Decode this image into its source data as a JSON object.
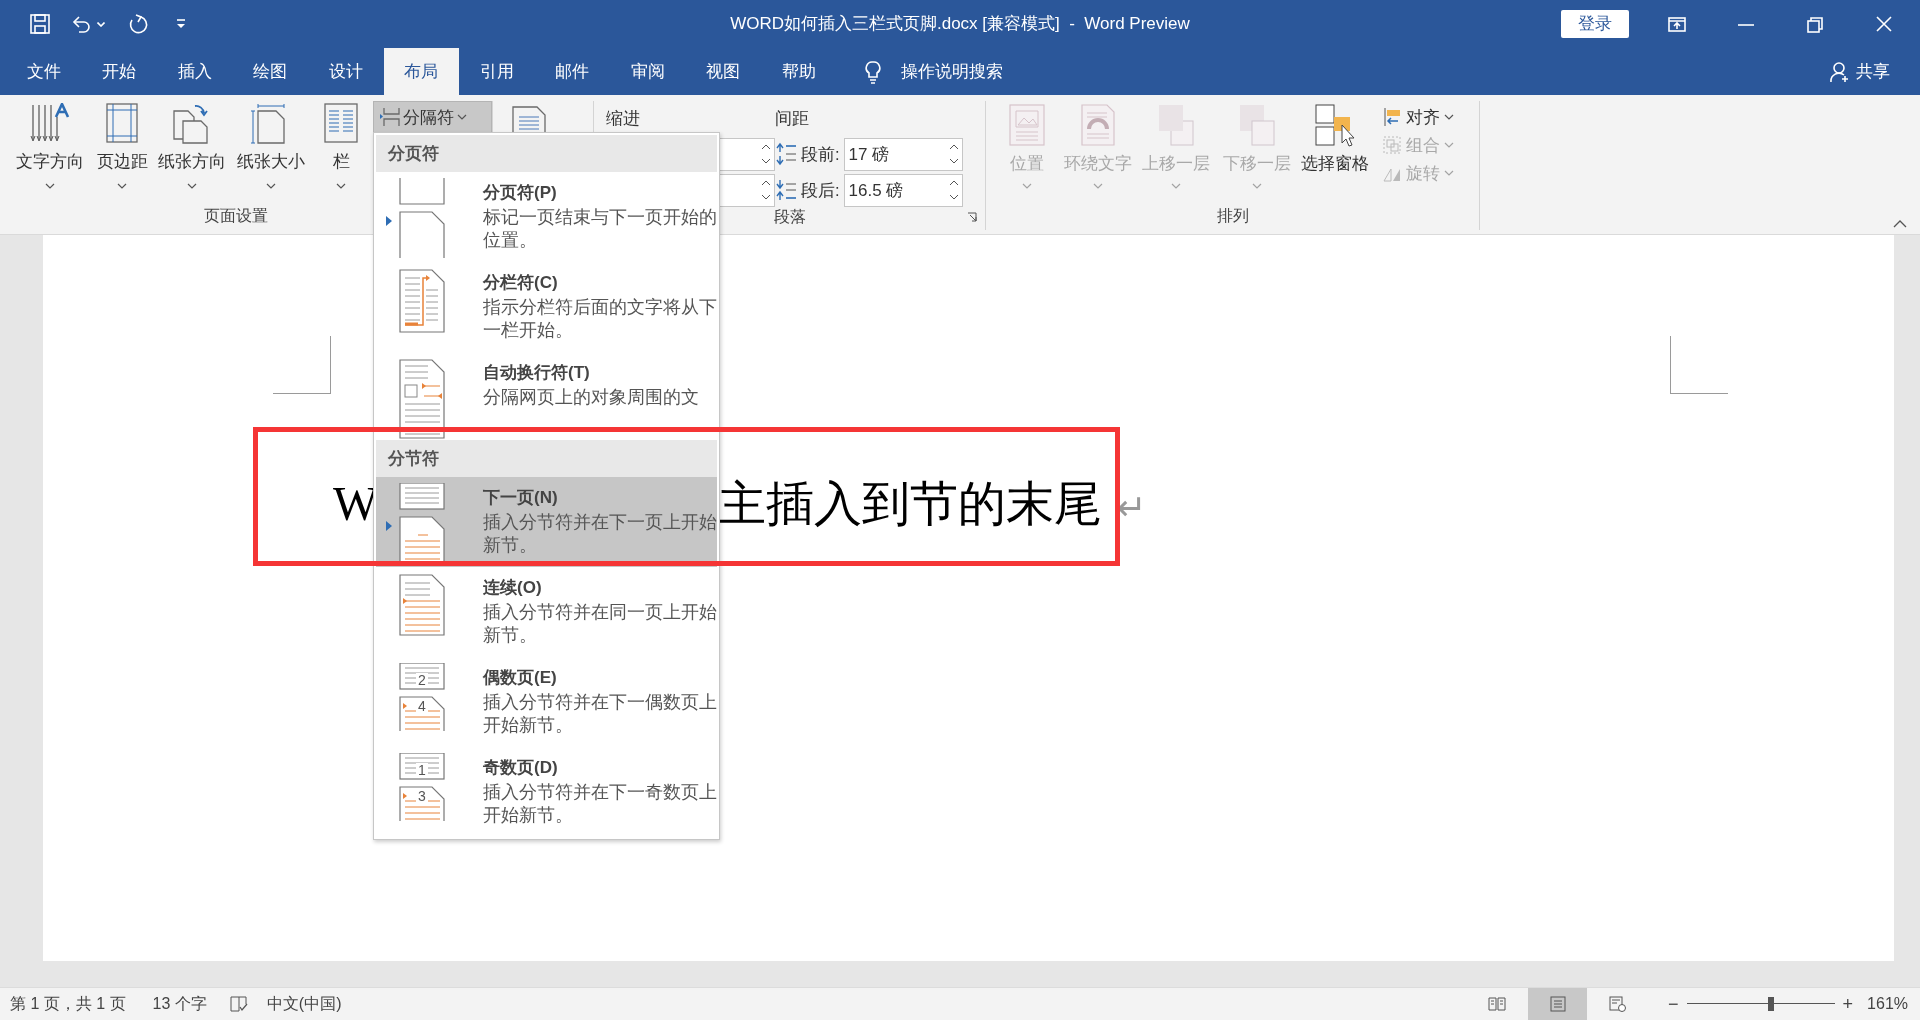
{
  "title_bar": {
    "title": "WORD如何插入三栏式页脚.docx [兼容模式]  -  Word Preview",
    "sign_in": "登录"
  },
  "tabs": [
    {
      "label": "文件",
      "selected": false
    },
    {
      "label": "开始",
      "selected": false
    },
    {
      "label": "插入",
      "selected": false
    },
    {
      "label": "绘图",
      "selected": false
    },
    {
      "label": "设计",
      "selected": false
    },
    {
      "label": "布局",
      "selected": true
    },
    {
      "label": "引用",
      "selected": false
    },
    {
      "label": "邮件",
      "selected": false
    },
    {
      "label": "审阅",
      "selected": false
    },
    {
      "label": "视图",
      "selected": false
    },
    {
      "label": "帮助",
      "selected": false
    }
  ],
  "tell_me": "操作说明搜索",
  "share": "共享",
  "ribbon": {
    "page_setup": {
      "label": "页面设置",
      "buttons": [
        {
          "kind": "text-direction",
          "label": "文字方向"
        },
        {
          "kind": "margins",
          "label": "页边距"
        },
        {
          "kind": "orientation",
          "label": "纸张方向"
        },
        {
          "kind": "size",
          "label": "纸张大小"
        },
        {
          "kind": "columns",
          "label": "栏"
        }
      ],
      "breaks_button": {
        "label": "分隔符",
        "pressed": true
      }
    },
    "paragraph": {
      "label": "段落",
      "indent_label": "缩进",
      "spacing_label": "间距",
      "spacing": [
        {
          "kind": "before",
          "label": "段前:",
          "value": "17 磅"
        },
        {
          "kind": "after",
          "label": "段后:",
          "value": "16.5 磅"
        }
      ]
    },
    "arrange": {
      "label": "排列",
      "buttons": [
        {
          "kind": "position",
          "label": "位置",
          "disabled": true
        },
        {
          "kind": "wrap",
          "label": "环绕文字",
          "disabled": true
        },
        {
          "kind": "forward",
          "label": "上移一层",
          "disabled": true
        },
        {
          "kind": "backward",
          "label": "下移一层",
          "disabled": true
        },
        {
          "kind": "pane",
          "label": "选择窗格",
          "disabled": false
        }
      ],
      "small_buttons": [
        {
          "kind": "align",
          "label": "对齐",
          "disabled": false
        },
        {
          "kind": "group",
          "label": "组合",
          "disabled": true
        },
        {
          "kind": "rotate",
          "label": "旋转",
          "disabled": true
        }
      ]
    }
  },
  "breaks_menu": {
    "sections": [
      {
        "heading": "分页符",
        "items": [
          {
            "kind": "page",
            "title": "分页符(P)",
            "description": "标记一页结束与下一页开始的位置。",
            "selected": false,
            "marked": true
          },
          {
            "kind": "column",
            "title": "分栏符(C)",
            "description": "指示分栏符后面的文字将从下一栏开始。",
            "selected": false,
            "marked": false
          },
          {
            "kind": "wrap",
            "title": "自动换行符(T)",
            "description": "分隔网页上的对象周围的文",
            "selected": false,
            "marked": false
          }
        ]
      },
      {
        "heading": "分节符",
        "items": [
          {
            "kind": "next",
            "title": "下一页(N)",
            "description": "插入分节符并在下一页上开始新节。",
            "selected": true,
            "marked": true
          },
          {
            "kind": "continuous",
            "title": "连续(O)",
            "description": "插入分节符并在同一页上开始新节。",
            "selected": false,
            "marked": false
          },
          {
            "kind": "even",
            "title": "偶数页(E)",
            "description": "插入分节符并在下一偶数页上开始新节。",
            "selected": false,
            "marked": false,
            "icon_labels": [
              "2",
              "4"
            ]
          },
          {
            "kind": "odd",
            "title": "奇数页(D)",
            "description": "插入分节符并在下一奇数页上开始新节。",
            "selected": false,
            "marked": false,
            "icon_labels": [
              "1",
              "3"
            ]
          }
        ]
      }
    ]
  },
  "document": {
    "text_before": "W",
    "text_after": "主插入到节的末尾",
    "paragraph_mark": "↵"
  },
  "annotation": {
    "kind": "frame"
  },
  "status_bar": {
    "page": "第 1 页，共 1 页",
    "words": "13 个字",
    "language": "中文(中国)",
    "views": [
      {
        "kind": "read",
        "selected": false
      },
      {
        "kind": "print",
        "selected": true
      },
      {
        "kind": "web",
        "selected": false
      }
    ],
    "zoom": {
      "minus": "−",
      "plus": "+",
      "level": 0.57,
      "reading": "161%"
    }
  }
}
